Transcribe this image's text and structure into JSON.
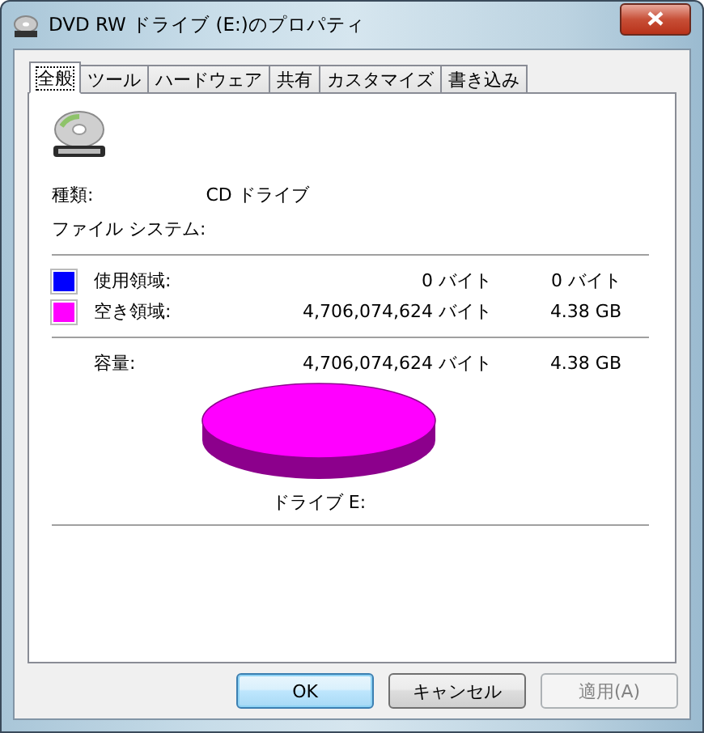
{
  "window": {
    "title": "DVD RW ドライブ (E:)のプロパティ"
  },
  "tabs": [
    {
      "label": "全般",
      "selected": true
    },
    {
      "label": "ツール",
      "selected": false
    },
    {
      "label": "ハードウェア",
      "selected": false
    },
    {
      "label": "共有",
      "selected": false
    },
    {
      "label": "カスタマイズ",
      "selected": false
    },
    {
      "label": "書き込み",
      "selected": false
    }
  ],
  "properties": [
    {
      "label": "種類:",
      "value": "CD ドライブ"
    },
    {
      "label": "ファイル システム:"
    }
  ],
  "space": [
    {
      "label": "使用領域:",
      "bytes": "0 バイト",
      "size": "0 バイト",
      "color": "#0000ff"
    },
    {
      "label": "空き領域:",
      "bytes": "4,706,074,624 バイト",
      "size": "4.38 GB",
      "color": "#ff00ff"
    }
  ],
  "capacity": {
    "label": "容量:",
    "bytes": "4,706,074,624 バイト",
    "size": "4.38 GB"
  },
  "chart_caption": "ドライブ E:",
  "buttons": [
    {
      "label": "OK",
      "default": true,
      "disabled": false
    },
    {
      "label": "キャンセル",
      "default": false,
      "disabled": false
    },
    {
      "label": "適用(A)",
      "default": false,
      "disabled": true
    }
  ]
}
